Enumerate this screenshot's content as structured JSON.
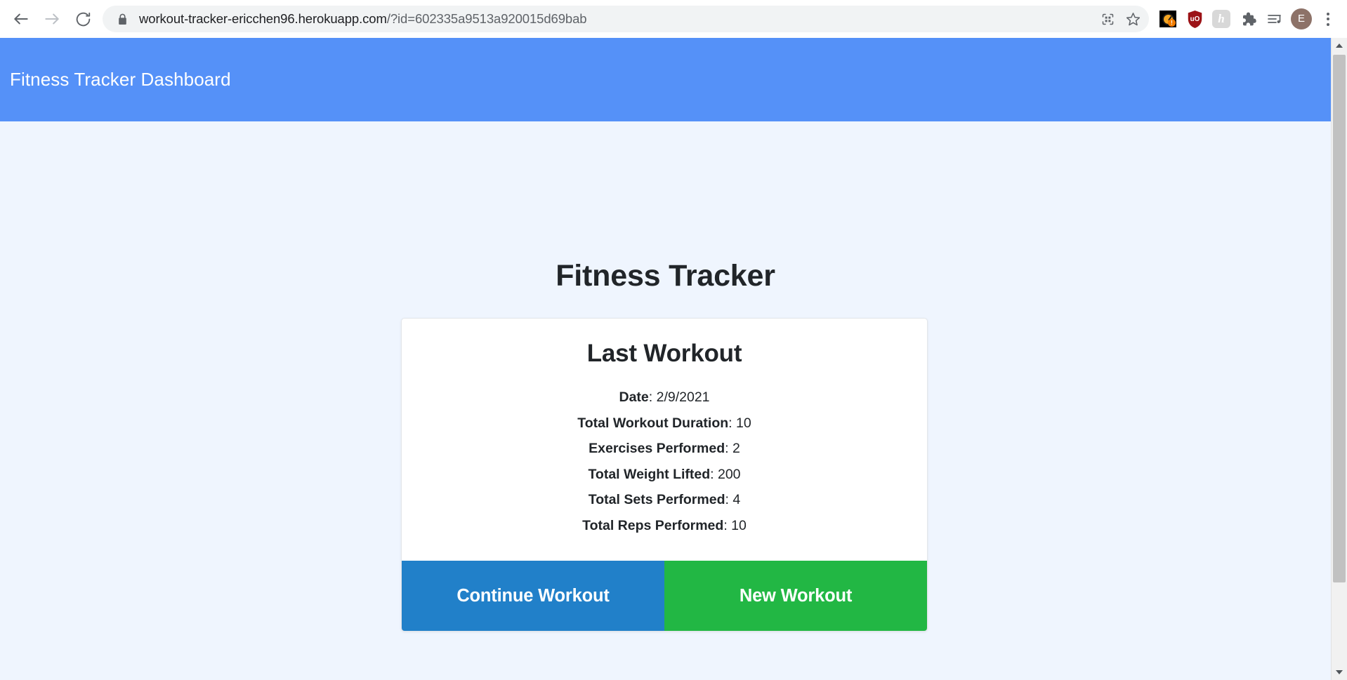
{
  "browser": {
    "back_label": "Back",
    "forward_label": "Forward",
    "reload_label": "Reload",
    "security_icon": "lock-icon",
    "url_domain": "workout-tracker-ericchen96.herokuapp.com",
    "url_query": "/?id=602335a9513a920015d69bab",
    "url_full": "workout-tracker-ericchen96.herokuapp.com/?id=602335a9513a920015d69bab",
    "omnibox_actions": [
      {
        "name": "qr-code-icon",
        "label": "Create QR Code for this page"
      },
      {
        "name": "bookmark-star-icon",
        "label": "Bookmark this tab"
      }
    ],
    "extensions": [
      {
        "name": "clock-alert-extension-icon",
        "label": "Clock extension",
        "badge": "!"
      },
      {
        "name": "ublock-origin-icon",
        "label": "uBlock Origin",
        "glyph": "uO"
      },
      {
        "name": "honey-extension-icon",
        "label": "Honey",
        "glyph": "h"
      },
      {
        "name": "extensions-puzzle-icon",
        "label": "Extensions"
      },
      {
        "name": "media-playlist-icon",
        "label": "Media controls"
      }
    ],
    "profile": {
      "name": "avatar",
      "initial": "E",
      "color": "#8d7268"
    },
    "menu_label": "Customize and control Google Chrome"
  },
  "app": {
    "header_title": "Fitness Tracker Dashboard",
    "header_color": "#5591f8",
    "background_color": "#eff5fe",
    "page_title": "Fitness Tracker"
  },
  "card": {
    "title": "Last Workout",
    "stats": [
      {
        "label": "Date",
        "separator": ": ",
        "value": "2/9/2021"
      },
      {
        "label": "Total Workout Duration",
        "separator": ": ",
        "value": "10"
      },
      {
        "label": "Exercises Performed",
        "separator": ": ",
        "value": "2"
      },
      {
        "label": "Total Weight Lifted",
        "separator": ": ",
        "value": "200"
      },
      {
        "label": "Total Sets Performed",
        "separator": ": ",
        "value": "4"
      },
      {
        "label": "Total Reps Performed",
        "separator": ": ",
        "value": "10"
      }
    ],
    "buttons": {
      "continue": {
        "label": "Continue Workout",
        "color": "#2180c9"
      },
      "new": {
        "label": "New Workout",
        "color": "#22b744"
      }
    }
  },
  "scrollbar": {
    "up_label": "Scroll up",
    "down_label": "Scroll down",
    "thumb_label": "Vertical scrollbar"
  }
}
